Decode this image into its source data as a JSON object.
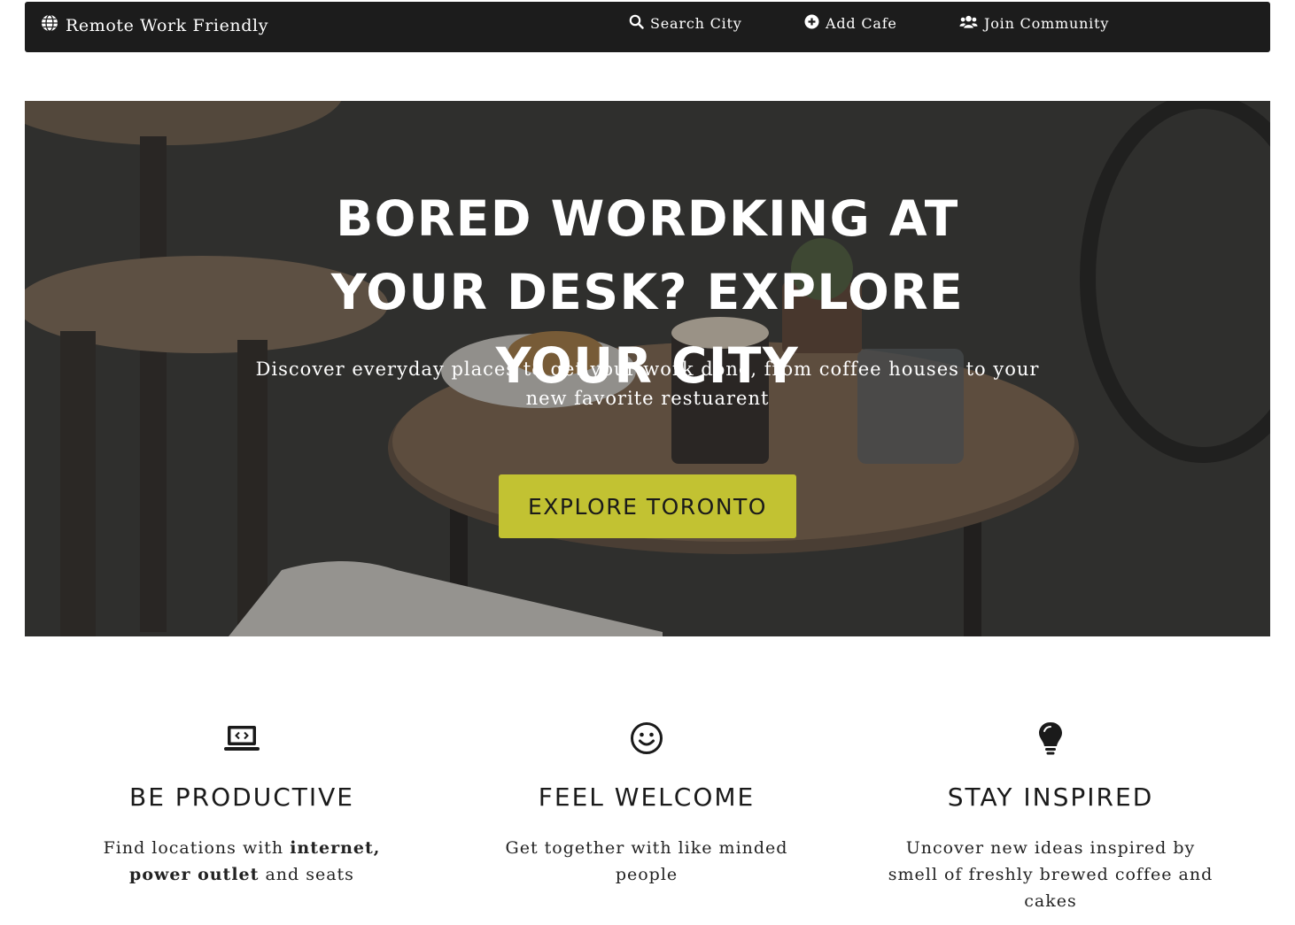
{
  "navbar": {
    "brand": "Remote Work Friendly",
    "links": [
      {
        "label": "Search City",
        "icon": "search-icon"
      },
      {
        "label": "Add Cafe",
        "icon": "plus-circle-icon"
      },
      {
        "label": "Join Community",
        "icon": "users-icon"
      }
    ]
  },
  "hero": {
    "title": "BORED WORDKING AT YOUR DESK? EXPLORE YOUR CITY",
    "subtitle": "Discover everyday places to get your work done, from coffee houses to your new favorite restuarent",
    "button": "EXPLORE TORONTO"
  },
  "features": [
    {
      "icon": "laptop-code-icon",
      "title": "BE PRODUCTIVE",
      "text_before": "Find locations with ",
      "text_bold": "internet, power outlet",
      "text_after": " and seats"
    },
    {
      "icon": "smile-icon",
      "title": "FEEL WELCOME",
      "text": "Get together with like minded people"
    },
    {
      "icon": "lightbulb-icon",
      "title": "STAY INSPIRED",
      "text": "Uncover new ideas inspired by smell of freshly brewed coffee and cakes"
    }
  ],
  "colors": {
    "navbar_bg": "#1c1c1c",
    "button_bg": "#c2c232",
    "text": "#222222"
  }
}
